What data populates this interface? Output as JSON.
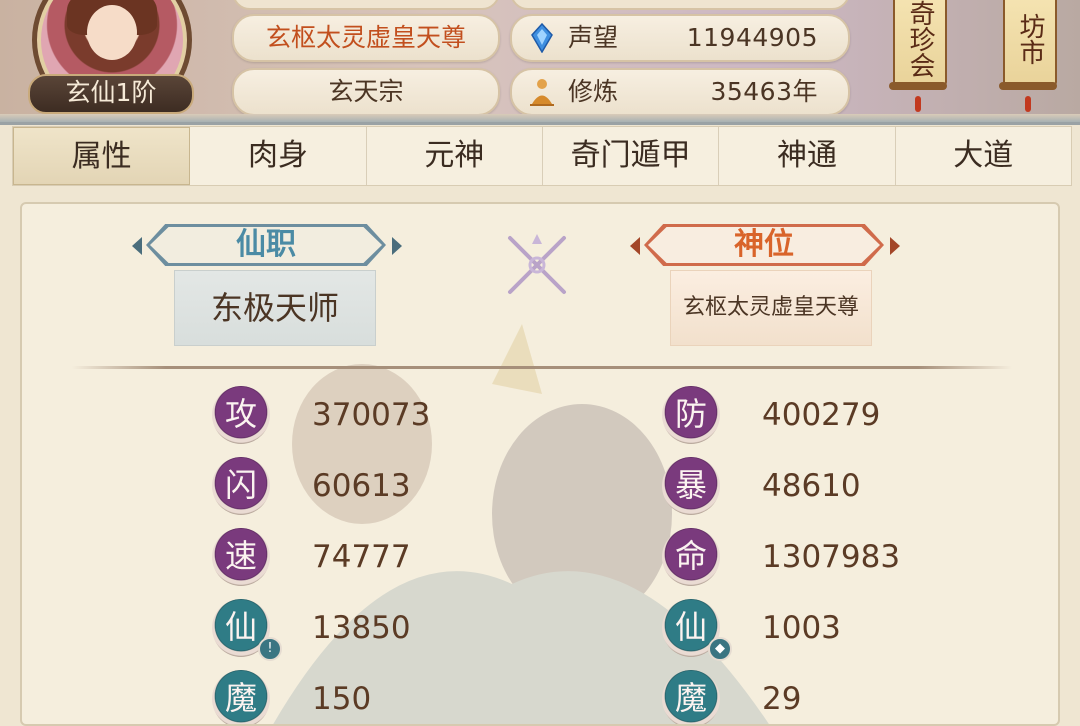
{
  "player": {
    "rank": "玄仙1阶",
    "title": "玄枢太灵虚皇天尊",
    "sect": "玄天宗"
  },
  "stats_header": {
    "fame_label": "声望",
    "fame_value": "11944905",
    "cultivation_label": "修炼",
    "cultivation_value": "35463年"
  },
  "side_buttons": {
    "treasure_auction": "奇珍会",
    "market": "坊市"
  },
  "tabs": [
    {
      "label": "属性",
      "active": true
    },
    {
      "label": "肉身"
    },
    {
      "label": "元神"
    },
    {
      "label": "奇门遁甲"
    },
    {
      "label": "神通"
    },
    {
      "label": "大道"
    }
  ],
  "positions": {
    "official_label": "仙职",
    "official_value": "东极天师",
    "divine_label": "神位",
    "divine_value": "玄枢太灵虚皇天尊"
  },
  "attributes": {
    "left": [
      {
        "glyph": "攻",
        "value": "370073"
      },
      {
        "glyph": "闪",
        "value": "60613"
      },
      {
        "glyph": "速",
        "value": "74777"
      },
      {
        "glyph": "仙",
        "value": "13850"
      },
      {
        "glyph": "魔",
        "value": "150"
      }
    ],
    "right": [
      {
        "glyph": "防",
        "value": "400279"
      },
      {
        "glyph": "暴",
        "value": "48610"
      },
      {
        "glyph": "命",
        "value": "1307983"
      },
      {
        "glyph": "仙",
        "value": "1003"
      },
      {
        "glyph": "魔",
        "value": "29"
      }
    ]
  },
  "colors": {
    "accent_title": "#c24f1e",
    "stat_badge_purple": "#7a3a7d",
    "stat_badge_teal": "#2f7c86"
  }
}
